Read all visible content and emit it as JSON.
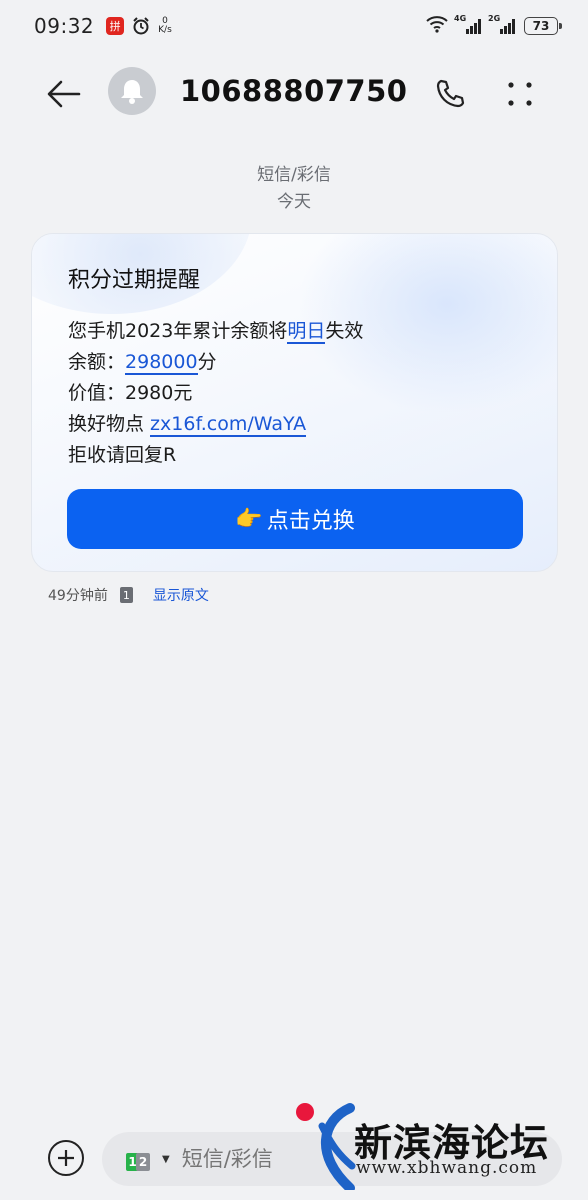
{
  "status_bar": {
    "time": "09:32",
    "app_badge": "拼",
    "net_speed_value": "0",
    "net_speed_unit": "K/s",
    "signal1_tag": "4G",
    "signal2_tag": "2G",
    "battery": "73"
  },
  "header": {
    "contact": "10688807750..."
  },
  "conversation": {
    "type_label": "短信/彩信",
    "date_label": "今天"
  },
  "card": {
    "title": "积分过期提醒",
    "line1_prefix": "您手机2023年累计余额将",
    "line1_link": "明日",
    "line1_suffix": "失效",
    "line2_prefix": "余额：",
    "line2_link": "298000",
    "line2_suffix": "分",
    "line3": "价值：2980元",
    "line4_prefix": "换好物点 ",
    "line4_link": "zx16f.com/WaYA",
    "line5": "拒收请回复R",
    "cta_emoji": "👉",
    "cta_label": "点击兑换"
  },
  "message_meta": {
    "time_ago": "49分钟前",
    "sim_slot": "1",
    "show_original": "显示原文"
  },
  "composer": {
    "sim1": "1",
    "sim2": "2",
    "placeholder": "短信/彩信"
  },
  "watermark": {
    "site_name": "新滨海论坛",
    "site_url": "www.xbhwang.com"
  },
  "colors": {
    "accent": "#0b62f1",
    "link": "#1a57d6",
    "background": "#f1f2f4"
  }
}
